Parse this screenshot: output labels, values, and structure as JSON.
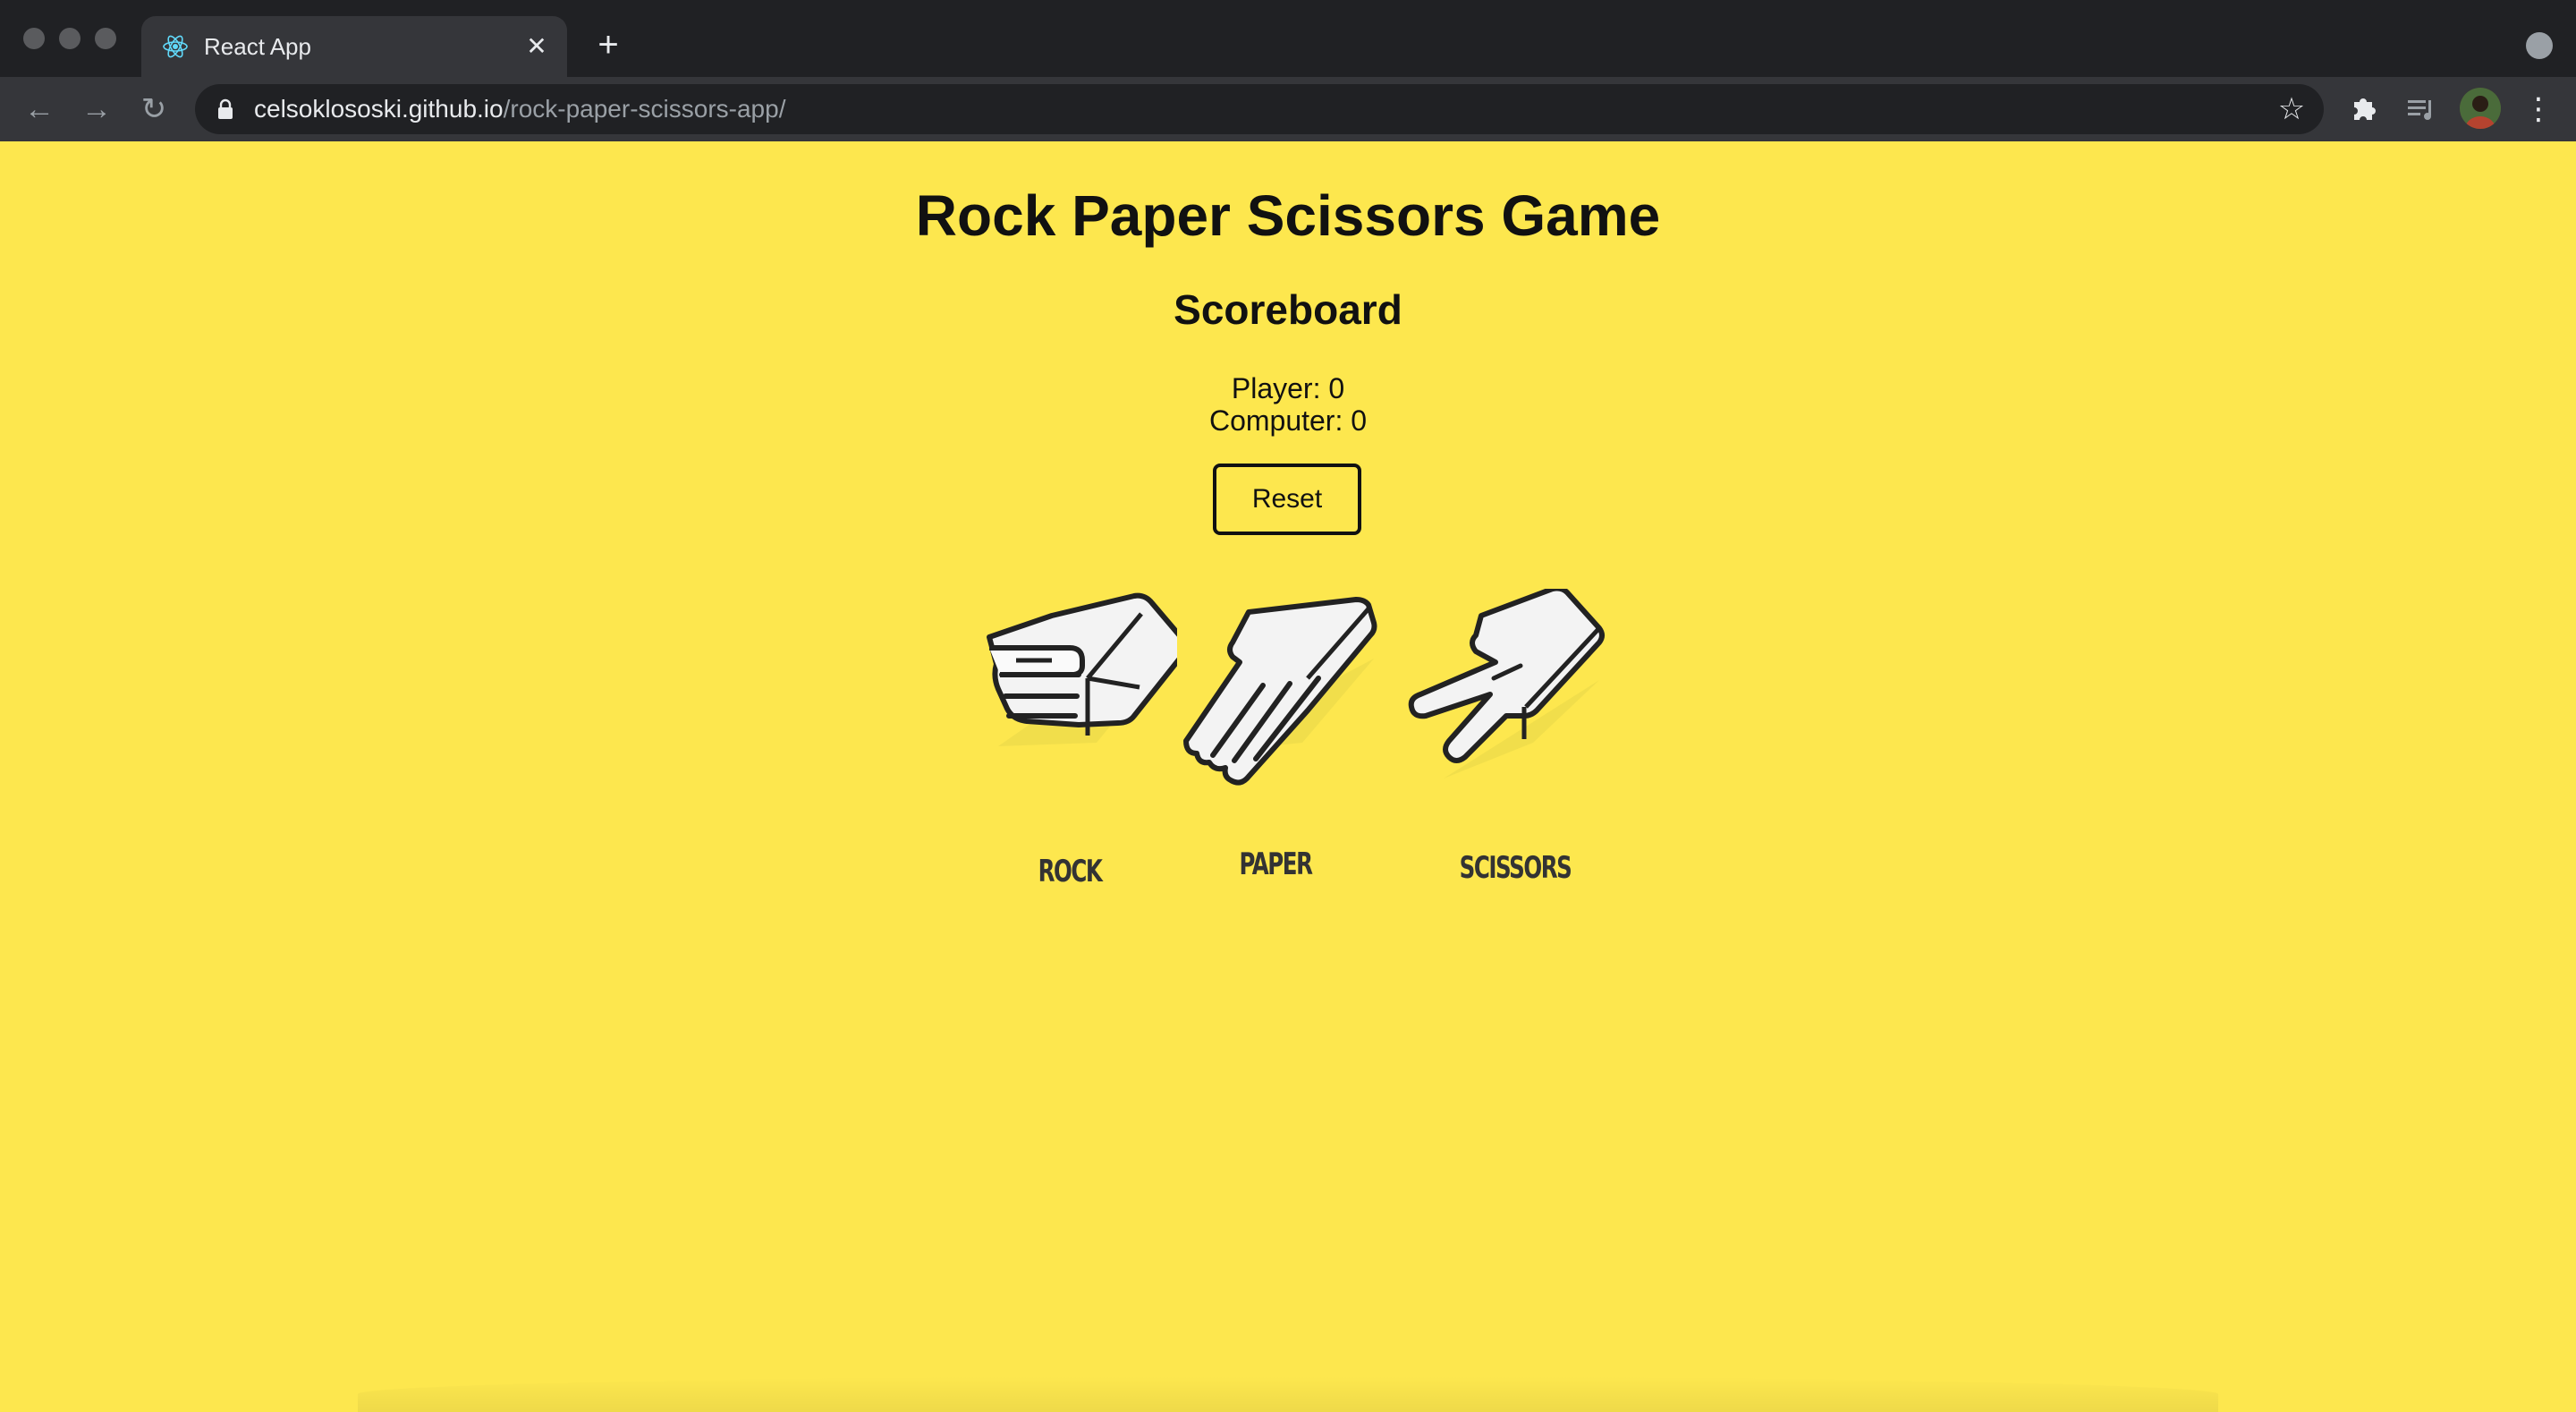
{
  "browser": {
    "tab_title": "React App",
    "url_host": "celsoklososki.github.io",
    "url_path": "/rock-paper-scissors-app/",
    "icons": [
      "react-favicon-icon",
      "close-icon",
      "plus-icon",
      "back-icon",
      "forward-icon",
      "reload-icon",
      "lock-icon",
      "star-icon",
      "puzzle-icon",
      "media-icon",
      "avatar",
      "menu-icon"
    ]
  },
  "page": {
    "title": "Rock Paper Scissors Game",
    "scoreboard_heading": "Scoreboard",
    "player_score": "Player: 0",
    "computer_score": "Computer: 0",
    "reset_label": "Reset",
    "choices": [
      {
        "label": "ROCK",
        "icon": "rock-hand-icon"
      },
      {
        "label": "PAPER",
        "icon": "paper-hand-icon"
      },
      {
        "label": "SCISSORS",
        "icon": "scissors-hand-icon"
      }
    ]
  },
  "colors": {
    "page_background": "#fde74e",
    "text": "#111111",
    "chrome_dark": "#202124",
    "chrome": "#35363a"
  }
}
